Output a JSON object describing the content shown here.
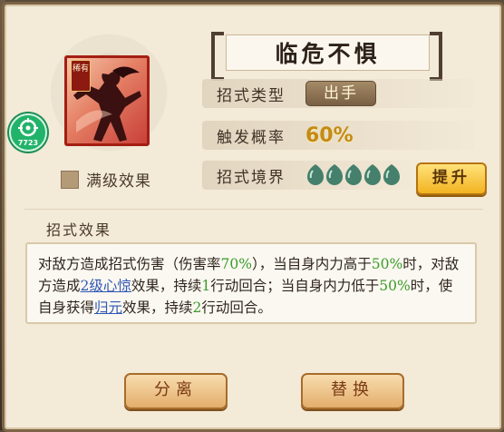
{
  "skill": {
    "name": "临危不惧",
    "rarity_badge": "稀有",
    "max_level_label": "满级效果"
  },
  "attributes": {
    "type_label": "招式类型",
    "type_value": "出手",
    "prob_label": "触发概率",
    "prob_value": "60%",
    "realm_label": "招式境界",
    "realm_level": 5,
    "upgrade_label": "提升"
  },
  "effect": {
    "header": "招式效果",
    "segments": [
      "对敌方造成招式伤害（伤害率",
      "70%",
      "），当自身内力高于",
      "50%",
      "时，对敌方造成",
      "2级心惊",
      "效果，持续",
      "1",
      "行动回合；当自身内力低于",
      "50%",
      "时，使自身获得",
      "归元",
      "效果，持续",
      "2",
      "行动回合。"
    ]
  },
  "buttons": {
    "split": "分离",
    "swap": "替换"
  },
  "overlay": {
    "badge_number": "7723"
  },
  "colors": {
    "highlight_green": "#3b9c2a",
    "link_blue": "#2f57b4",
    "prob_gold": "#c58b12",
    "upgrade_gold": "#f2b321"
  }
}
